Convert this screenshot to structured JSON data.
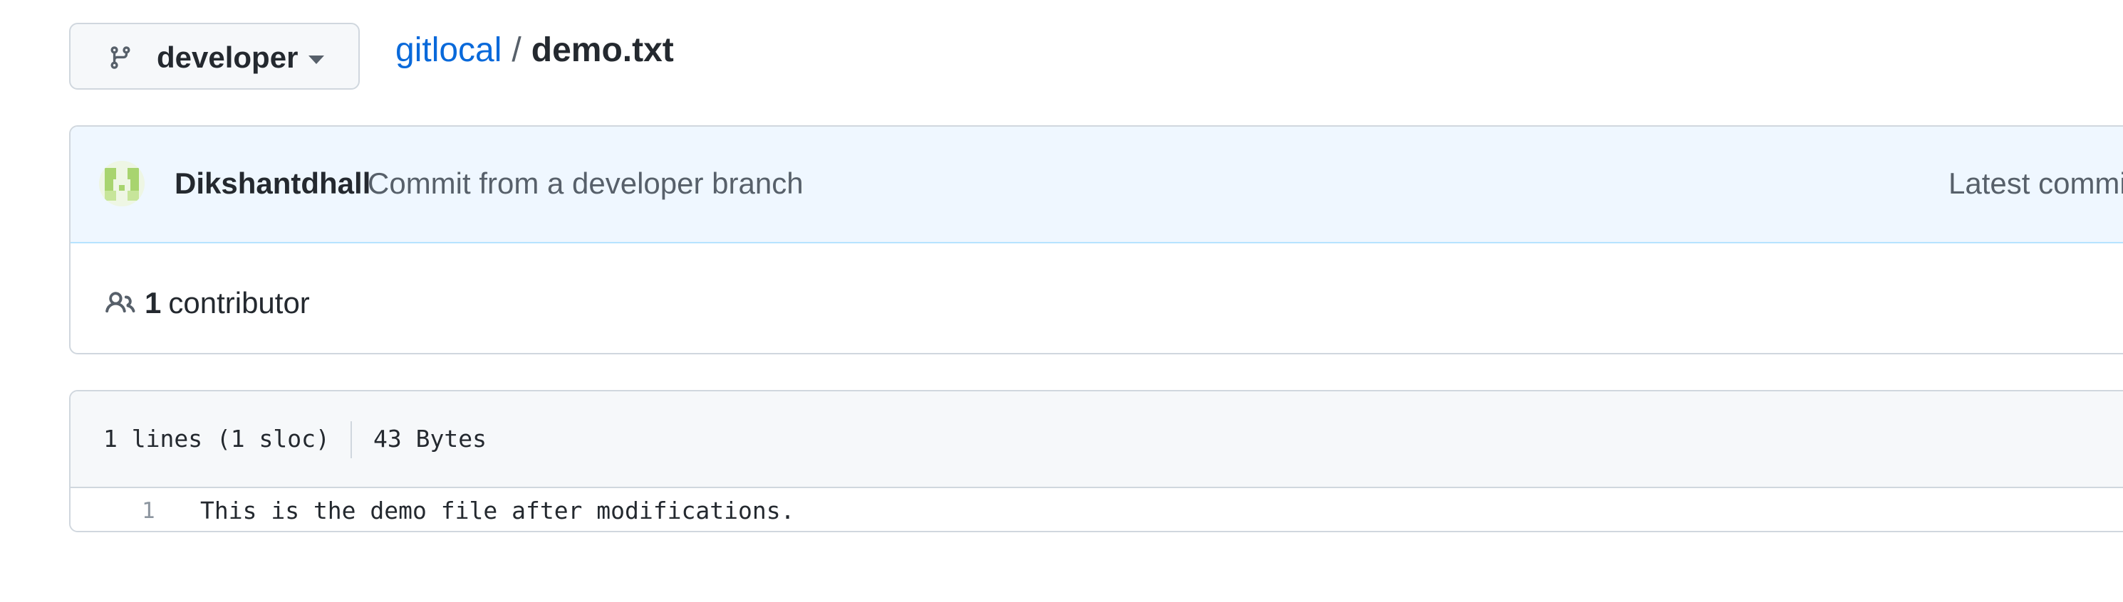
{
  "branch": {
    "name": "developer",
    "icon": "git-branch-icon"
  },
  "breadcrumb": {
    "repo": "gitlocal",
    "separator": "/",
    "file": "demo.txt"
  },
  "commit": {
    "author": "Dikshantdhall",
    "message": "Commit from a developer branch",
    "latest_label": "Latest commi",
    "avatar_icon": "identicon-avatar"
  },
  "contributors": {
    "count": "1",
    "label": "contributor",
    "icon": "people-icon"
  },
  "file": {
    "lines_info": "1 lines (1 sloc)",
    "size": "43 Bytes",
    "code_lines": [
      {
        "number": "1",
        "text": "This is the demo file after modifications."
      }
    ]
  },
  "colors": {
    "link": "#0969da",
    "commit_bg": "#eff7ff",
    "border": "#d0d7de",
    "avatar": "#a8d46f"
  }
}
